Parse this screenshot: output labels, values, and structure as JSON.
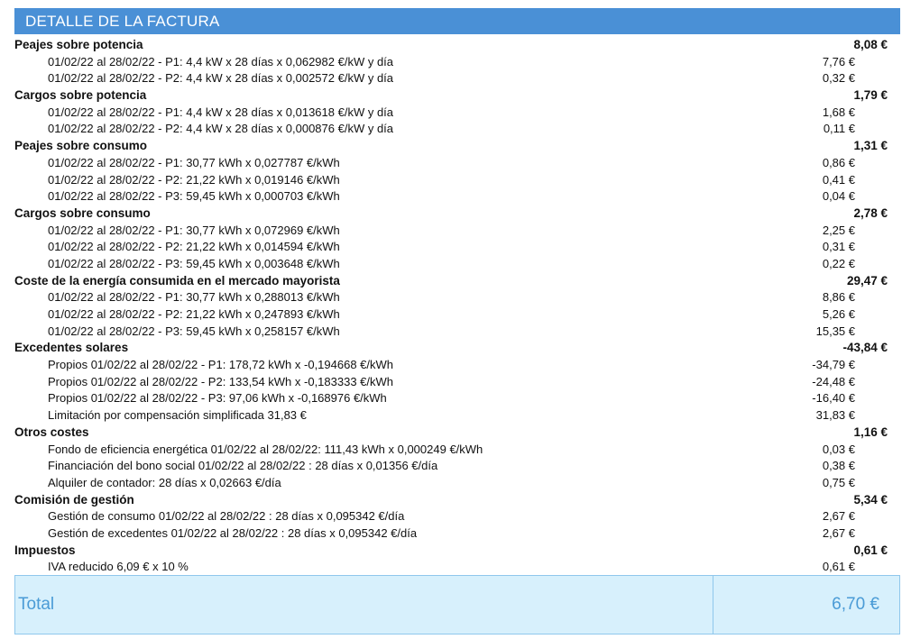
{
  "header": {
    "title": "DETALLE DE LA FACTURA"
  },
  "sections": [
    {
      "title": "Peajes sobre potencia",
      "total": "8,08 €",
      "items": [
        {
          "desc": "01/02/22 al 28/02/22 - P1: 4,4 kW x 28 días x 0,062982 €/kW y día",
          "amount": "7,76 €"
        },
        {
          "desc": "01/02/22 al 28/02/22 - P2: 4,4 kW x 28 días x 0,002572 €/kW y día",
          "amount": "0,32 €"
        }
      ]
    },
    {
      "title": "Cargos sobre potencia",
      "total": "1,79 €",
      "items": [
        {
          "desc": "01/02/22 al 28/02/22 - P1: 4,4 kW x 28 días x 0,013618 €/kW y día",
          "amount": "1,68 €"
        },
        {
          "desc": "01/02/22 al 28/02/22 - P2: 4,4 kW x 28 días x 0,000876 €/kW y día",
          "amount": "0,11 €"
        }
      ]
    },
    {
      "title": "Peajes sobre consumo",
      "total": "1,31 €",
      "items": [
        {
          "desc": "01/02/22 al 28/02/22 - P1: 30,77 kWh x 0,027787 €/kWh",
          "amount": "0,86 €"
        },
        {
          "desc": "01/02/22 al 28/02/22 - P2: 21,22 kWh x 0,019146 €/kWh",
          "amount": "0,41 €"
        },
        {
          "desc": "01/02/22 al 28/02/22 - P3: 59,45 kWh x 0,000703 €/kWh",
          "amount": "0,04 €"
        }
      ]
    },
    {
      "title": "Cargos sobre consumo",
      "total": "2,78 €",
      "items": [
        {
          "desc": "01/02/22 al 28/02/22 - P1: 30,77 kWh x 0,072969 €/kWh",
          "amount": "2,25 €"
        },
        {
          "desc": "01/02/22 al 28/02/22 - P2: 21,22 kWh x 0,014594 €/kWh",
          "amount": "0,31 €"
        },
        {
          "desc": "01/02/22 al 28/02/22 - P3: 59,45 kWh x 0,003648 €/kWh",
          "amount": "0,22 €"
        }
      ]
    },
    {
      "title": "Coste de la energía consumida en el mercado mayorista",
      "total": "29,47 €",
      "items": [
        {
          "desc": "01/02/22 al 28/02/22 - P1: 30,77 kWh x 0,288013 €/kWh",
          "amount": "8,86 €"
        },
        {
          "desc": "01/02/22 al 28/02/22 - P2: 21,22 kWh x 0,247893 €/kWh",
          "amount": "5,26 €"
        },
        {
          "desc": "01/02/22 al 28/02/22 - P3: 59,45 kWh x 0,258157 €/kWh",
          "amount": "15,35 €"
        }
      ]
    },
    {
      "title": "Excedentes solares",
      "total": "-43,84 €",
      "items": [
        {
          "desc": "Propios 01/02/22 al 28/02/22 - P1: 178,72 kWh x -0,194668 €/kWh",
          "amount": "-34,79 €"
        },
        {
          "desc": "Propios 01/02/22 al 28/02/22 - P2: 133,54 kWh x -0,183333 €/kWh",
          "amount": "-24,48 €"
        },
        {
          "desc": "Propios 01/02/22 al 28/02/22 - P3: 97,06 kWh x -0,168976 €/kWh",
          "amount": "-16,40 €"
        },
        {
          "desc": "Limitación por compensación simplificada 31,83 €",
          "amount": "31,83 €"
        }
      ]
    },
    {
      "title": "Otros costes",
      "total": "1,16 €",
      "items": [
        {
          "desc": "Fondo de eficiencia energética 01/02/22 al 28/02/22: 111,43 kWh x 0,000249 €/kWh",
          "amount": "0,03 €"
        },
        {
          "desc": "Financiación del bono social 01/02/22 al 28/02/22 : 28 días x 0,01356 €/día",
          "amount": "0,38 €"
        },
        {
          "desc": "Alquiler de contador: 28 días x 0,02663 €/día",
          "amount": "0,75 €"
        }
      ]
    },
    {
      "title": "Comisión de gestión",
      "total": "5,34 €",
      "items": [
        {
          "desc": "Gestión de consumo 01/02/22 al 28/02/22 : 28 días x 0,095342 €/día",
          "amount": "2,67 €"
        },
        {
          "desc": "Gestión de excedentes 01/02/22 al 28/02/22 : 28 días x 0,095342 €/día",
          "amount": "2,67 €"
        }
      ]
    },
    {
      "title": "Impuestos",
      "total": "0,61 €",
      "items": [
        {
          "desc": "IVA reducido 6,09 € x 10 %",
          "amount": "0,61 €"
        }
      ]
    }
  ],
  "total": {
    "label": "Total",
    "value": "6,70 €"
  }
}
